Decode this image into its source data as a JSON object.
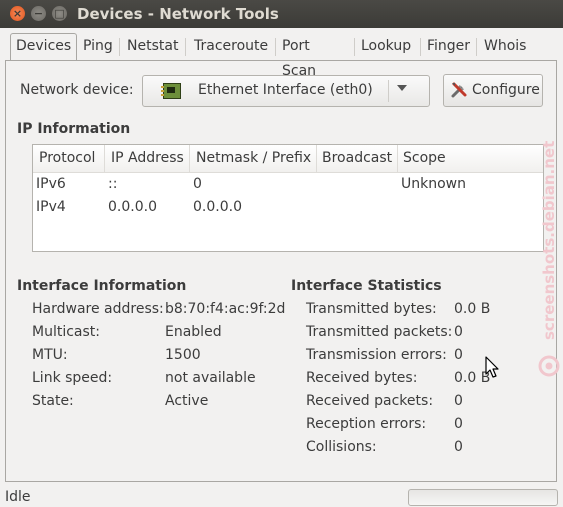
{
  "window": {
    "title": "Devices - Network Tools",
    "close": "×",
    "minimize": "−",
    "maximize": "□"
  },
  "tabs": [
    "Devices",
    "Ping",
    "Netstat",
    "Traceroute",
    "Port Scan",
    "Lookup",
    "Finger",
    "Whois"
  ],
  "active_tab": "Devices",
  "device": {
    "label": "Network device:",
    "selected": "Ethernet Interface (eth0)",
    "configure_label": "Configure"
  },
  "ip_info": {
    "heading": "IP Information",
    "columns": [
      "Protocol",
      "IP Address",
      "Netmask / Prefix",
      "Broadcast",
      "Scope"
    ],
    "rows": [
      [
        "IPv6",
        "::",
        "0",
        "",
        "Unknown"
      ],
      [
        "IPv4",
        "0.0.0.0",
        "0.0.0.0",
        "",
        ""
      ]
    ]
  },
  "interface_info": {
    "heading": "Interface Information",
    "items": [
      {
        "label": "Hardware address:",
        "value": "b8:70:f4:ac:9f:2d"
      },
      {
        "label": "Multicast:",
        "value": "Enabled"
      },
      {
        "label": "MTU:",
        "value": "1500"
      },
      {
        "label": "Link speed:",
        "value": "not available"
      },
      {
        "label": "State:",
        "value": "Active"
      }
    ]
  },
  "interface_stats": {
    "heading": "Interface Statistics",
    "items": [
      {
        "label": "Transmitted bytes:",
        "value": "0.0 B"
      },
      {
        "label": "Transmitted packets:",
        "value": "0"
      },
      {
        "label": "Transmission errors:",
        "value": "0"
      },
      {
        "label": "Received bytes:",
        "value": "0.0 B"
      },
      {
        "label": "Received packets:",
        "value": "0"
      },
      {
        "label": "Reception errors:",
        "value": "0"
      },
      {
        "label": "Collisions:",
        "value": "0"
      }
    ]
  },
  "status": {
    "text": "Idle",
    "progress": 0
  },
  "watermark": "screenshots.debian.net",
  "colors": {
    "titlebar": "#3c3b37",
    "close_button": "#e2551d",
    "window_bg": "#f2f1f0"
  }
}
